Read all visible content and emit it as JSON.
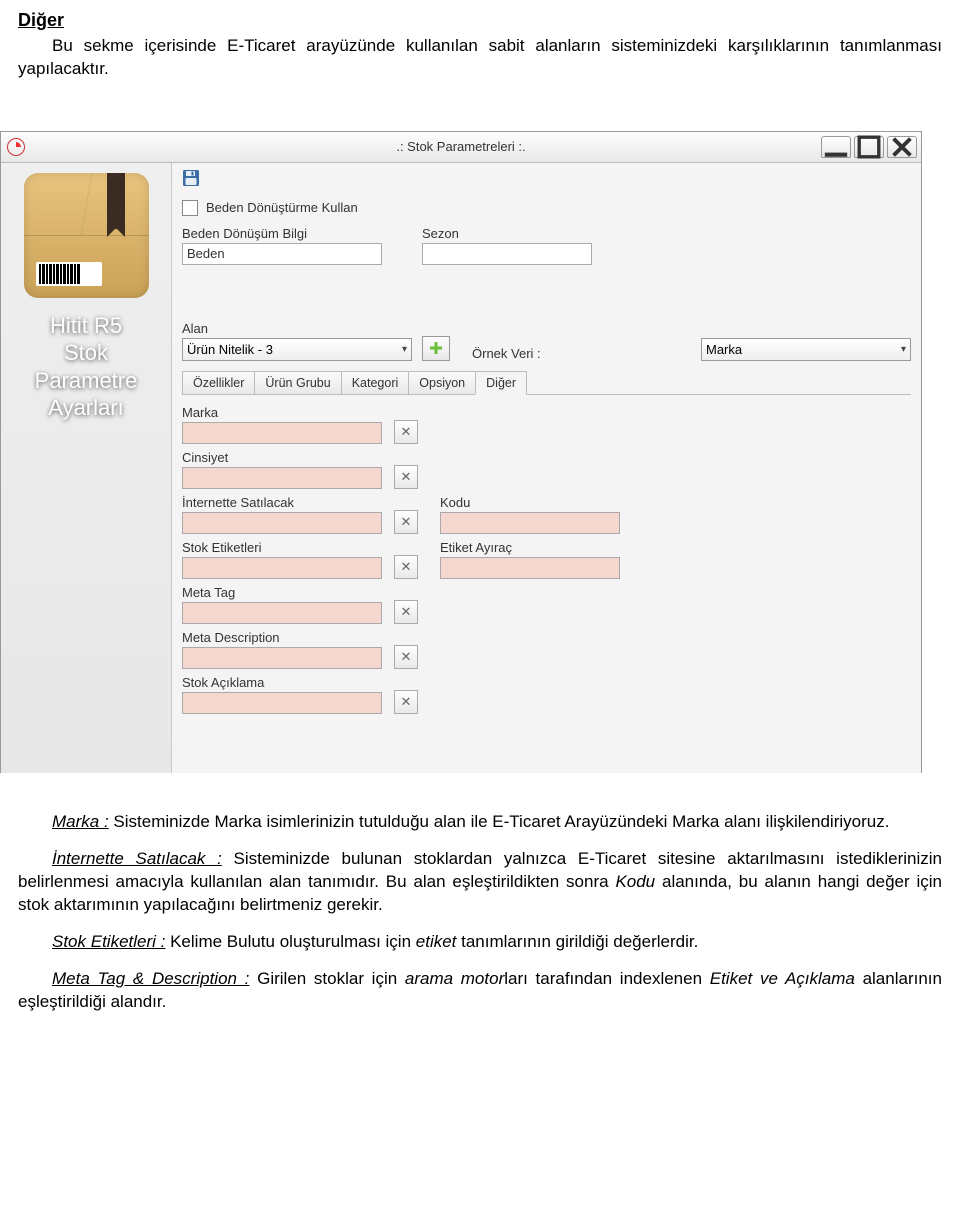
{
  "doc": {
    "section_title": "Diğer",
    "intro": "Bu sekme içerisinde E-Ticaret arayüzünde kullanılan sabit alanların sisteminizdeki karşılıklarının tanımlanması yapılacaktır.",
    "p_marka_term": "Marka :",
    "p_marka_text": " Sisteminizde Marka isimlerinizin tutulduğu alan ile E-Ticaret Arayüzündeki Marka alanı ilişkilendiriyoruz.",
    "p_internette_term": "İnternette Satılacak :",
    "p_internette_text": " Sisteminizde bulunan stoklardan yalnızca E-Ticaret sitesine aktarılmasını istediklerinizin belirlenmesi amacıyla kullanılan alan tanımıdır. Bu alan eşleştirildikten sonra ",
    "p_internette_kodu": "Kodu",
    "p_internette_tail": " alanında, bu alanın hangi değer için stok aktarımının yapılacağını belirtmeniz gerekir.",
    "p_stoketiket_term": "Stok Etiketleri :",
    "p_stoketiket_text": " Kelime Bulutu oluşturulması için ",
    "p_stoketiket_etiket": "etiket",
    "p_stoketiket_tail": " tanımlarının girildiği değerlerdir.",
    "p_meta_term": "Meta Tag & Description :",
    "p_meta_text": " Girilen stoklar için ",
    "p_meta_arama": "arama motor",
    "p_meta_tail1": "ları tarafından indexlenen ",
    "p_meta_etiket": "Etiket ve Açıklama",
    "p_meta_tail2": " alanlarının eşleştirildiği alandır."
  },
  "window": {
    "title": ".: Stok Parametreleri :.",
    "panel_title": "Hitit R5\nStok\nParametre\nAyarları",
    "checkbox_label": "Beden Dönüştürme Kullan",
    "beden_donusum_label": "Beden Dönüşüm Bilgi",
    "beden_donusum_value": "Beden",
    "sezon_label": "Sezon",
    "sezon_value": "",
    "alan_label": "Alan",
    "alan_value": "Ürün Nitelik - 3",
    "ornek_veri_label": "Örnek Veri :",
    "ornek_veri_value": "Marka",
    "tabs": {
      "ozellikler": "Özellikler",
      "urun_grubu": "Ürün Grubu",
      "kategori": "Kategori",
      "opsiyon": "Opsiyon",
      "diger": "Diğer"
    },
    "fields": {
      "marka": "Marka",
      "cinsiyet": "Cinsiyet",
      "internette": "İnternette Satılacak",
      "kodu": "Kodu",
      "stok_etiketleri": "Stok Etiketleri",
      "etiket_ayirac": "Etiket Ayıraç",
      "meta_tag": "Meta Tag",
      "meta_desc": "Meta Description",
      "stok_aciklama": "Stok Açıklama"
    }
  }
}
